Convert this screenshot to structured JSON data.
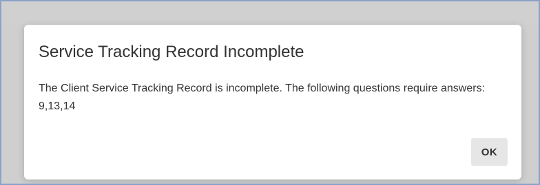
{
  "dialog": {
    "title": "Service Tracking Record Incomplete",
    "message": "The Client Service Tracking Record is incomplete. The following questions require answers: 9,13,14",
    "ok_label": "OK"
  },
  "colors": {
    "backdrop": "#cfcfcf",
    "dialog_background": "#ffffff",
    "button_background": "#e6e6e6",
    "frame_border": "#8aa2c8",
    "text": "#333333"
  }
}
